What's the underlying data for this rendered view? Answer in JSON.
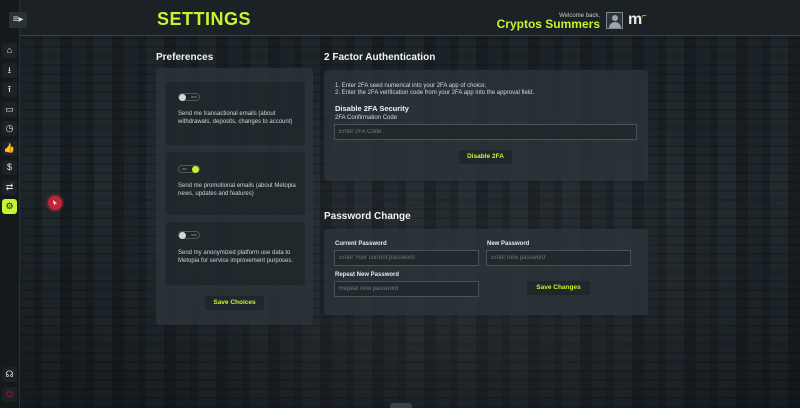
{
  "header": {
    "page_title": "SETTINGS",
    "welcome": "Welcome back,",
    "username": "Cryptos Summers",
    "logo": "m"
  },
  "sidebar": {
    "items": [
      {
        "icon": "home-icon",
        "glyph": "⌂"
      },
      {
        "icon": "download-icon",
        "glyph": "⭳"
      },
      {
        "icon": "upload-icon",
        "glyph": "⭱"
      },
      {
        "icon": "folder-icon",
        "glyph": "▭"
      },
      {
        "icon": "history-icon",
        "glyph": "◷"
      },
      {
        "icon": "thumbs-up-icon",
        "glyph": "👍"
      },
      {
        "icon": "dollar-icon",
        "glyph": "$"
      },
      {
        "icon": "transfer-icon",
        "glyph": "⇄"
      },
      {
        "icon": "settings-icon",
        "glyph": "⚙",
        "active": true
      }
    ],
    "bottom": [
      {
        "icon": "headset-icon",
        "glyph": "☊"
      },
      {
        "icon": "power-icon",
        "glyph": "⏻"
      }
    ]
  },
  "preferences": {
    "title": "Preferences",
    "items": [
      {
        "state": "OFF",
        "on": false,
        "text": "Send me transactional emails (about withdrawals, deposits, changes to account)"
      },
      {
        "state": "ON",
        "on": true,
        "text": "Send me promotional emails (about Metopia news, updates and features)"
      },
      {
        "state": "OFF",
        "on": false,
        "text": "Send my anonymized platform use data to Metopia for service improvement purposes."
      }
    ],
    "save_label": "Save Choices"
  },
  "twofa": {
    "title": "2 Factor Authentication",
    "instructions": [
      "1. Enter 2FA seed numerical into your 2FA app of choice;",
      "2. Enter the 2FA verification code from your 2FA app into the approval field."
    ],
    "disable_title": "Disable 2FA Security",
    "code_label": "2FA Confirmation Code",
    "code_placeholder": "Enter 2FA Code",
    "disable_label": "Disable 2FA"
  },
  "password": {
    "title": "Password Change",
    "current_label": "Current Password",
    "current_placeholder": "Enter Your current password",
    "new_label": "New Password",
    "new_placeholder": "Enter new password",
    "repeat_label": "Repeat New Password",
    "repeat_placeholder": "Repeat new password",
    "save_label": "Save Changes"
  },
  "colors": {
    "accent": "#c6f432",
    "danger": "#c0253a"
  }
}
